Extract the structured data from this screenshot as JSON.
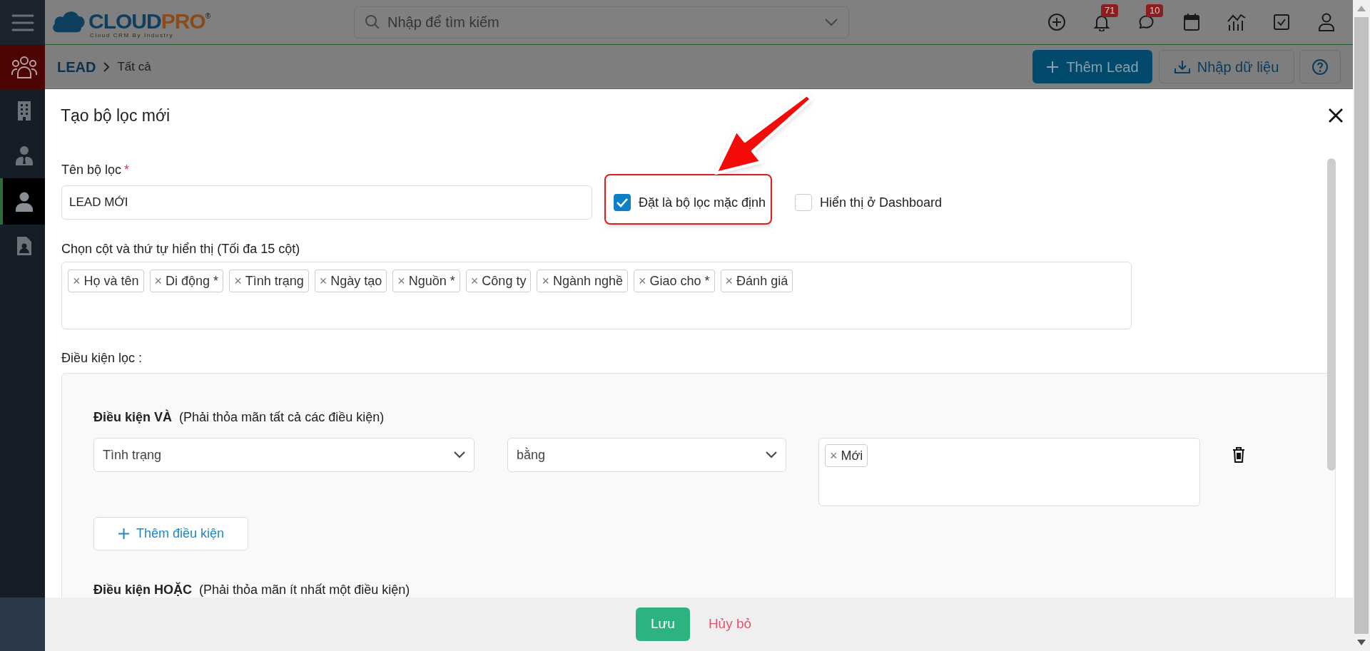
{
  "sidebar": {
    "items": [
      {
        "kind": "app",
        "selected": false
      },
      {
        "kind": "link",
        "selected": false
      },
      {
        "kind": "link",
        "selected": false
      },
      {
        "kind": "link",
        "selected": true
      },
      {
        "kind": "link",
        "selected": false
      }
    ]
  },
  "top_bar": {
    "logo": {
      "name": "CLOUD",
      "accent": "PRO",
      "mark": "®",
      "tagline": "Cloud CRM By Industry"
    },
    "search": {
      "placeholder": "Nhập để tìm kiếm"
    },
    "badges": [
      "71",
      "10"
    ]
  },
  "breadcrumb": [
    "LEAD",
    "Tất cả"
  ],
  "actions": [
    "Thêm Lead",
    "Nhập dữ liệu"
  ],
  "modal": {
    "title": "Tạo bộ lọc mới",
    "name_field": {
      "label": "Tên bộ lọc",
      "required_mark": "*",
      "value": "LEAD MỚI"
    },
    "options": [
      {
        "label": "Đặt là bộ lọc mặc định",
        "checked": true
      },
      {
        "label": "Hiển thị ở Dashboard",
        "checked": false
      }
    ],
    "columns": {
      "label": "Chọn cột và thứ tự hiển thị (Tối đa 15 cột)",
      "remove_mark": "×",
      "tags": [
        "Họ và tên",
        "Di động *",
        "Tình trạng",
        "Ngày tạo",
        "Nguồn *",
        "Công ty",
        "Ngành nghề",
        "Giao cho *",
        "Đánh giá"
      ]
    },
    "conditions": {
      "label": "Điều kiện lọc :",
      "groups": [
        {
          "title": "Điều kiện VÀ",
          "hint": "(Phải thỏa mãn tất cả các điều kiện)",
          "rows": [
            {
              "field": "Tình trạng",
              "operator": "bằng",
              "values": [
                "Mới"
              ]
            }
          ],
          "add_button": "Thêm điều kiện"
        },
        {
          "title": "Điều kiện HOẶC",
          "hint": "(Phải thỏa mãn ít nhất một điều kiện)"
        }
      ]
    },
    "footer": {
      "save": "Lưu",
      "cancel": "Hủy bỏ"
    }
  }
}
